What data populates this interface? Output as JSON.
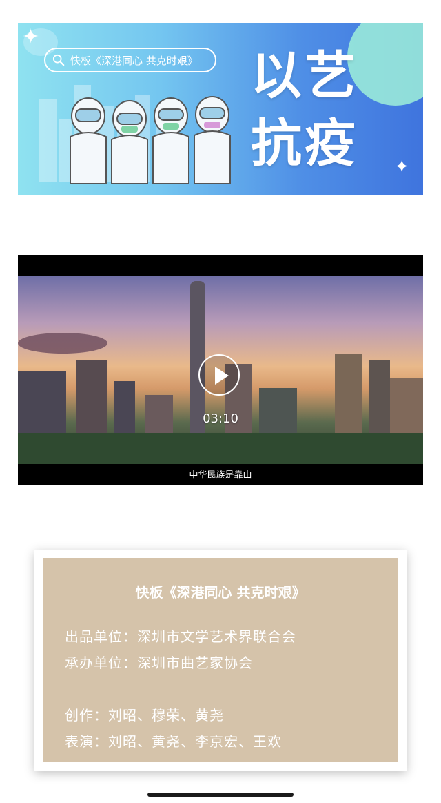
{
  "banner": {
    "search_text": "快板《深港同心 共克时艰》",
    "title_line1": "以艺",
    "title_line2": "抗疫",
    "icons": [
      "search-icon",
      "star-icon"
    ]
  },
  "video": {
    "duration": "03:10",
    "subtitle": "中华民族是靠山"
  },
  "card": {
    "title": "快板《深港同心 共克时艰》",
    "producer": "出品单位：深圳市文学艺术界联合会",
    "organizer": "承办单位：深圳市曲艺家协会",
    "creators": "创作：刘昭、穆荣、黄尧",
    "performers": "表演：刘昭、黄尧、李京宏、王欢"
  }
}
